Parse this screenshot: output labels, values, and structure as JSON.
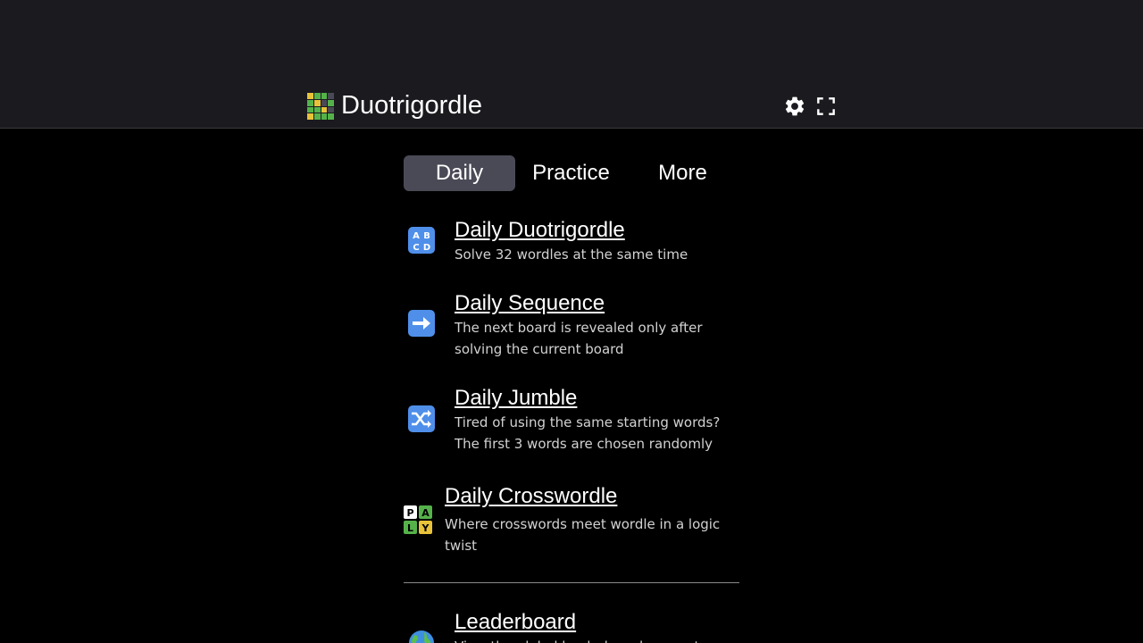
{
  "header": {
    "title": "Duotrigordle",
    "logo_colors": [
      "#e8c33a",
      "#55b24a",
      "#55b24a",
      "#4a4a57",
      "#55b24a",
      "#e8c33a",
      "#4a4a57",
      "#55b24a",
      "#55b24a",
      "#55b24a",
      "#e8c33a",
      "#4a4a57",
      "#e8c33a",
      "#55b24a",
      "#55b24a",
      "#55b24a"
    ],
    "settings_icon": "gear-icon",
    "fullscreen_icon": "fullscreen-icon"
  },
  "tabs": [
    {
      "label": "Daily",
      "active": true
    },
    {
      "label": "Practice",
      "active": false
    },
    {
      "label": "More",
      "active": false
    }
  ],
  "items": [
    {
      "icon": "abcd-icon",
      "name": "Daily Duotrigordle",
      "desc": "Solve 32 wordles at the same time"
    },
    {
      "icon": "right-arrow-icon",
      "name": "Daily Sequence",
      "desc": "The next board is revealed only after solving the current board"
    },
    {
      "icon": "shuffle-icon",
      "name": "Daily Jumble",
      "desc": "Tired of using the same starting words? The first 3 words are chosen randomly"
    },
    {
      "icon": "play-tiles-icon",
      "name": "Daily Crosswordle",
      "desc": "Where crosswords meet wordle in a logic twist",
      "tiles": [
        "P",
        "A",
        "L",
        "Y"
      ]
    },
    {
      "icon": "globe-icon",
      "name": "Leaderboard",
      "desc": "View the global leaderboard or create a"
    }
  ],
  "colors": {
    "accent_tab": "#4a4a57",
    "header_bg": "#1b1a1f",
    "emoji_blue": "#4f8fea",
    "tile_green": "#55b24a",
    "tile_yellow": "#e8c33a"
  }
}
